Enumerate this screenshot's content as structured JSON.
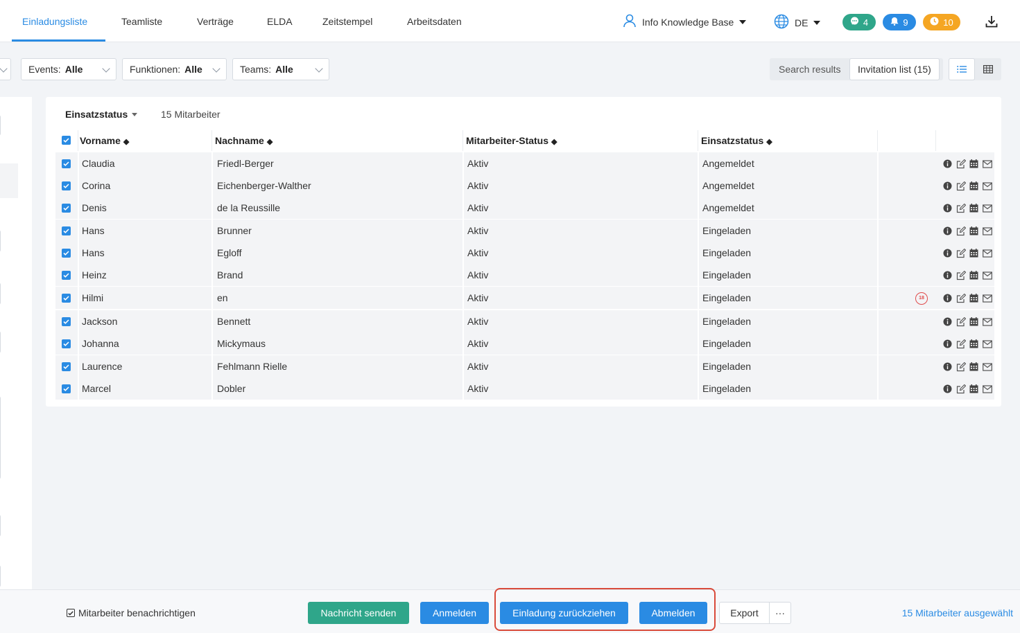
{
  "nav": {
    "tabs": [
      {
        "label": "Einladungsliste",
        "active": true
      },
      {
        "label": "Teamliste",
        "active": false
      },
      {
        "label": "Verträge",
        "active": false
      },
      {
        "label": "ELDA",
        "active": false
      },
      {
        "label": "Zeitstempel",
        "active": false
      },
      {
        "label": "Arbeitsdaten",
        "active": false
      }
    ],
    "user": "Info Knowledge Base",
    "language": "DE",
    "badges": {
      "messages": "4",
      "notifications": "9",
      "timers": "10"
    },
    "colors": {
      "accent": "#2a8be3",
      "messages": "#2fa68a",
      "notifications": "#2a8be3",
      "timers": "#f5a623"
    }
  },
  "filters": {
    "events": {
      "label": "Events:",
      "value": "Alle"
    },
    "functions": {
      "label": "Funktionen:",
      "value": "Alle"
    },
    "teams": {
      "label": "Teams:",
      "value": "Alle"
    }
  },
  "view_toggle": {
    "search_results": "Search results",
    "invitation_list": "Invitation list (15)"
  },
  "table": {
    "group_by": "Einsatzstatus",
    "count_label": "15 Mitarbeiter",
    "headers": {
      "first": "Vorname",
      "last": "Nachname",
      "emp_status": "Mitarbeiter-Status",
      "deploy_status": "Einsatzstatus"
    },
    "rows": [
      {
        "first": "Claudia",
        "last": "Friedl-Berger",
        "emp_status": "Aktiv",
        "deploy_status": "Angemeldet",
        "badge": ""
      },
      {
        "first": "Corina",
        "last": "Eichenberger-Walther",
        "emp_status": "Aktiv",
        "deploy_status": "Angemeldet",
        "badge": ""
      },
      {
        "first": "Denis",
        "last": "de la Reussille",
        "emp_status": "Aktiv",
        "deploy_status": "Angemeldet",
        "badge": ""
      },
      {
        "first": "Hans",
        "last": "Brunner",
        "emp_status": "Aktiv",
        "deploy_status": "Eingeladen",
        "badge": ""
      },
      {
        "first": "Hans",
        "last": "Egloff",
        "emp_status": "Aktiv",
        "deploy_status": "Eingeladen",
        "badge": ""
      },
      {
        "first": "Heinz",
        "last": "Brand",
        "emp_status": "Aktiv",
        "deploy_status": "Eingeladen",
        "badge": ""
      },
      {
        "first": "Hilmi",
        "last": "en",
        "emp_status": "Aktiv",
        "deploy_status": "Eingeladen",
        "badge": "18"
      },
      {
        "first": "Jackson",
        "last": "Bennett",
        "emp_status": "Aktiv",
        "deploy_status": "Eingeladen",
        "badge": ""
      },
      {
        "first": "Johanna",
        "last": "Mickymaus",
        "emp_status": "Aktiv",
        "deploy_status": "Eingeladen",
        "badge": ""
      },
      {
        "first": "Laurence",
        "last": "Fehlmann Rielle",
        "emp_status": "Aktiv",
        "deploy_status": "Eingeladen",
        "badge": ""
      },
      {
        "first": "Marcel",
        "last": "Dobler",
        "emp_status": "Aktiv",
        "deploy_status": "Eingeladen",
        "badge": ""
      }
    ],
    "row_action_icons": [
      "info-icon",
      "edit-icon",
      "calendar-icon",
      "mail-icon"
    ]
  },
  "footer": {
    "notify_label": "Mitarbeiter benachrichtigen",
    "notify_checked": true,
    "send_message": "Nachricht senden",
    "register": "Anmelden",
    "withdraw_invitation": "Einladung zurückziehen",
    "deregister": "Abmelden",
    "export": "Export",
    "more": "···",
    "selected_count": "15 Mitarbeiter ausgewählt",
    "highlight_color": "#d94a3a"
  }
}
